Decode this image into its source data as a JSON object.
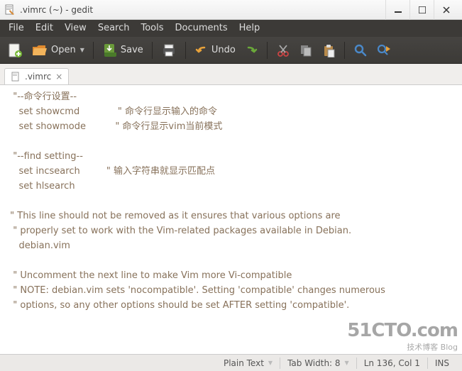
{
  "window": {
    "title": ".vimrc (~) - gedit"
  },
  "menubar": {
    "items": [
      "File",
      "Edit",
      "View",
      "Search",
      "Tools",
      "Documents",
      "Help"
    ]
  },
  "toolbar": {
    "new_label": "",
    "open_label": "Open",
    "save_label": "Save",
    "undo_label": "Undo"
  },
  "tabs": [
    {
      "label": ".vimrc"
    }
  ],
  "editor": {
    "content": "  \"--命令行设置--\n    set showcmd             \" 命令行显示输入的命令\n    set showmode          \" 命令行显示vim当前模式\n\n  \"--find setting--\n    set incsearch         \" 输入字符串就显示匹配点\n    set hlsearch\n\n \" This line should not be removed as it ensures that various options are\n  \" properly set to work with the Vim-related packages available in Debian.\n    debian.vim\n\n  \" Uncomment the next line to make Vim more Vi-compatible\n  \" NOTE: debian.vim sets 'nocompatible'. Setting 'compatible' changes numerous\n  \" options, so any other options should be set AFTER setting 'compatible'."
  },
  "statusbar": {
    "filetype": "Plain Text",
    "tabwidth": "Tab Width: 8",
    "position": "Ln 136, Col 1",
    "insert": "INS"
  },
  "watermark": {
    "big": "51CTO.com",
    "small": "技术博客    Blog"
  }
}
